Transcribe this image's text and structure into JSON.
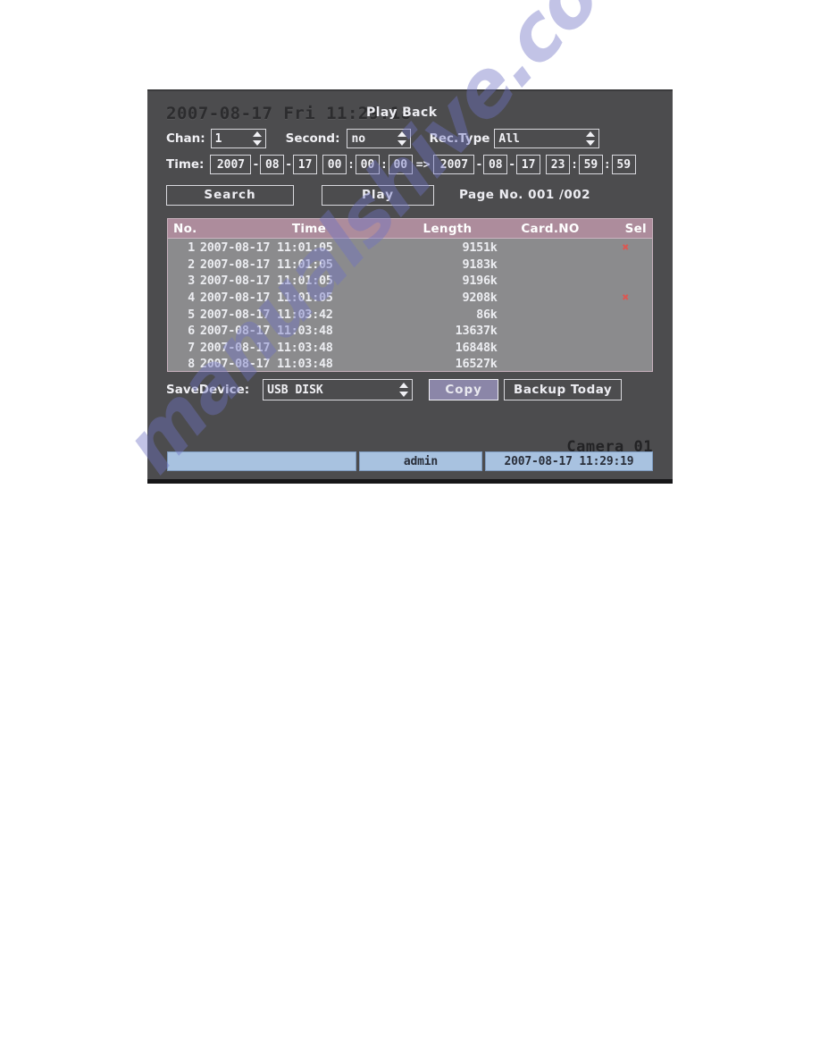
{
  "window": {
    "datetime_heading": "2007-08-17 Fri 11:29:18",
    "title": "Play Back"
  },
  "filters": {
    "chan_label": "Chan:",
    "chan_value": "1",
    "second_label": "Second:",
    "second_value": "no",
    "rectype_label": "Rec.Type",
    "rectype_value": "All",
    "time_label": "Time:",
    "range_arrow": "=>",
    "start": {
      "year": "2007",
      "month": "08",
      "day": "17",
      "hour": "00",
      "minute": "00",
      "second": "00"
    },
    "end": {
      "year": "2007",
      "month": "08",
      "day": "17",
      "hour": "23",
      "minute": "59",
      "second": "59"
    },
    "date_sep": "-",
    "time_sep": ":"
  },
  "actions": {
    "search_label": "Search",
    "play_label": "Play",
    "page_no": "Page No. 001 /002"
  },
  "record_list": {
    "columns": [
      "No.",
      "Time",
      "Length",
      "Card.NO",
      "Sel"
    ],
    "rows": [
      {
        "no": "1",
        "time": "2007-08-17 11:01:05",
        "length": "9151k",
        "card": "",
        "sel": "✖"
      },
      {
        "no": "2",
        "time": "2007-08-17 11:01:05",
        "length": "9183k",
        "card": "",
        "sel": ""
      },
      {
        "no": "3",
        "time": "2007-08-17 11:01:05",
        "length": "9196k",
        "card": "",
        "sel": ""
      },
      {
        "no": "4",
        "time": "2007-08-17 11:01:05",
        "length": "9208k",
        "card": "",
        "sel": "✖"
      },
      {
        "no": "5",
        "time": "2007-08-17 11:03:42",
        "length": "86k",
        "card": "",
        "sel": ""
      },
      {
        "no": "6",
        "time": "2007-08-17 11:03:48",
        "length": "13637k",
        "card": "",
        "sel": ""
      },
      {
        "no": "7",
        "time": "2007-08-17 11:03:48",
        "length": "16848k",
        "card": "",
        "sel": ""
      },
      {
        "no": "8",
        "time": "2007-08-17 11:03:48",
        "length": "16527k",
        "card": "",
        "sel": ""
      }
    ]
  },
  "backup": {
    "savedevice_label": "SaveDevice:",
    "savedevice_value": "USB DISK",
    "copy_label": "Copy",
    "backup_today_label": "Backup Today"
  },
  "overlay": {
    "camera_label": "Camera 01"
  },
  "status_bar": {
    "blank": "",
    "user": "admin",
    "timestamp": "2007-08-17 11:29:19"
  },
  "watermark": {
    "text": "manualshive.com"
  },
  "colors": {
    "panel_bg": "#4c4c4e",
    "list_bg": "#8b8b8d",
    "list_header": "#ad8c9c",
    "status_bar": "#a8c2e0",
    "selected_button": "#8b86a8",
    "sel_marker": "#e8504a",
    "watermark": "#6f73c4"
  }
}
